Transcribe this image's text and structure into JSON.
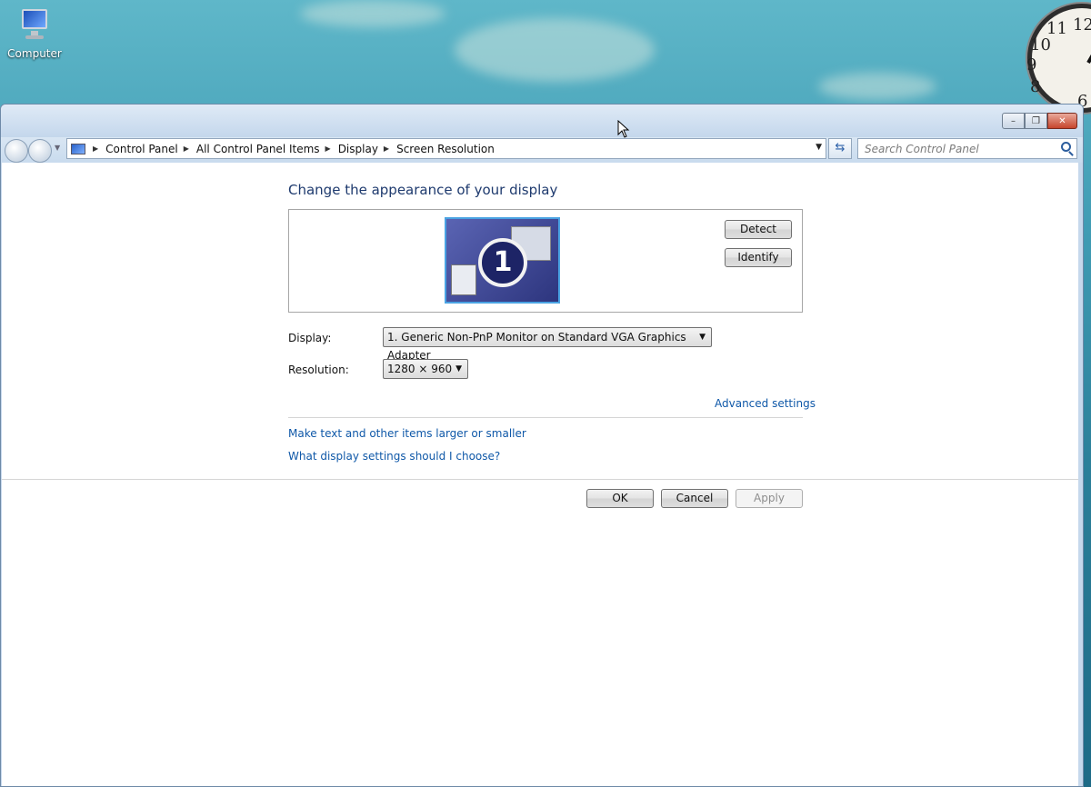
{
  "desktop": {
    "computer_icon_label": "Computer"
  },
  "clock": {
    "numerals": [
      "10",
      "11",
      "12",
      "9",
      "8",
      "6"
    ]
  },
  "window": {
    "caption": {
      "minimize": "–",
      "restore": "❐",
      "close": "✕"
    },
    "breadcrumb": [
      "Control Panel",
      "All Control Panel Items",
      "Display",
      "Screen Resolution"
    ],
    "search": {
      "placeholder": "Search Control Panel"
    },
    "content": {
      "heading": "Change the appearance of your display",
      "monitor_number": "1",
      "detect_button": "Detect",
      "identify_button": "Identify",
      "display_label": "Display:",
      "display_value": "1. Generic Non-PnP Monitor on Standard VGA Graphics Adapter",
      "resolution_label": "Resolution:",
      "resolution_value": "1280 × 960",
      "advanced_link": "Advanced settings",
      "larger_text_link": "Make text and other items larger or smaller",
      "help_link": "What display settings should I choose?",
      "ok_button": "OK",
      "cancel_button": "Cancel",
      "apply_button": "Apply"
    }
  },
  "colors": {
    "link": "#0f58a8",
    "heading": "#1e3a6e",
    "monitor_border": "#4aa3e3"
  }
}
